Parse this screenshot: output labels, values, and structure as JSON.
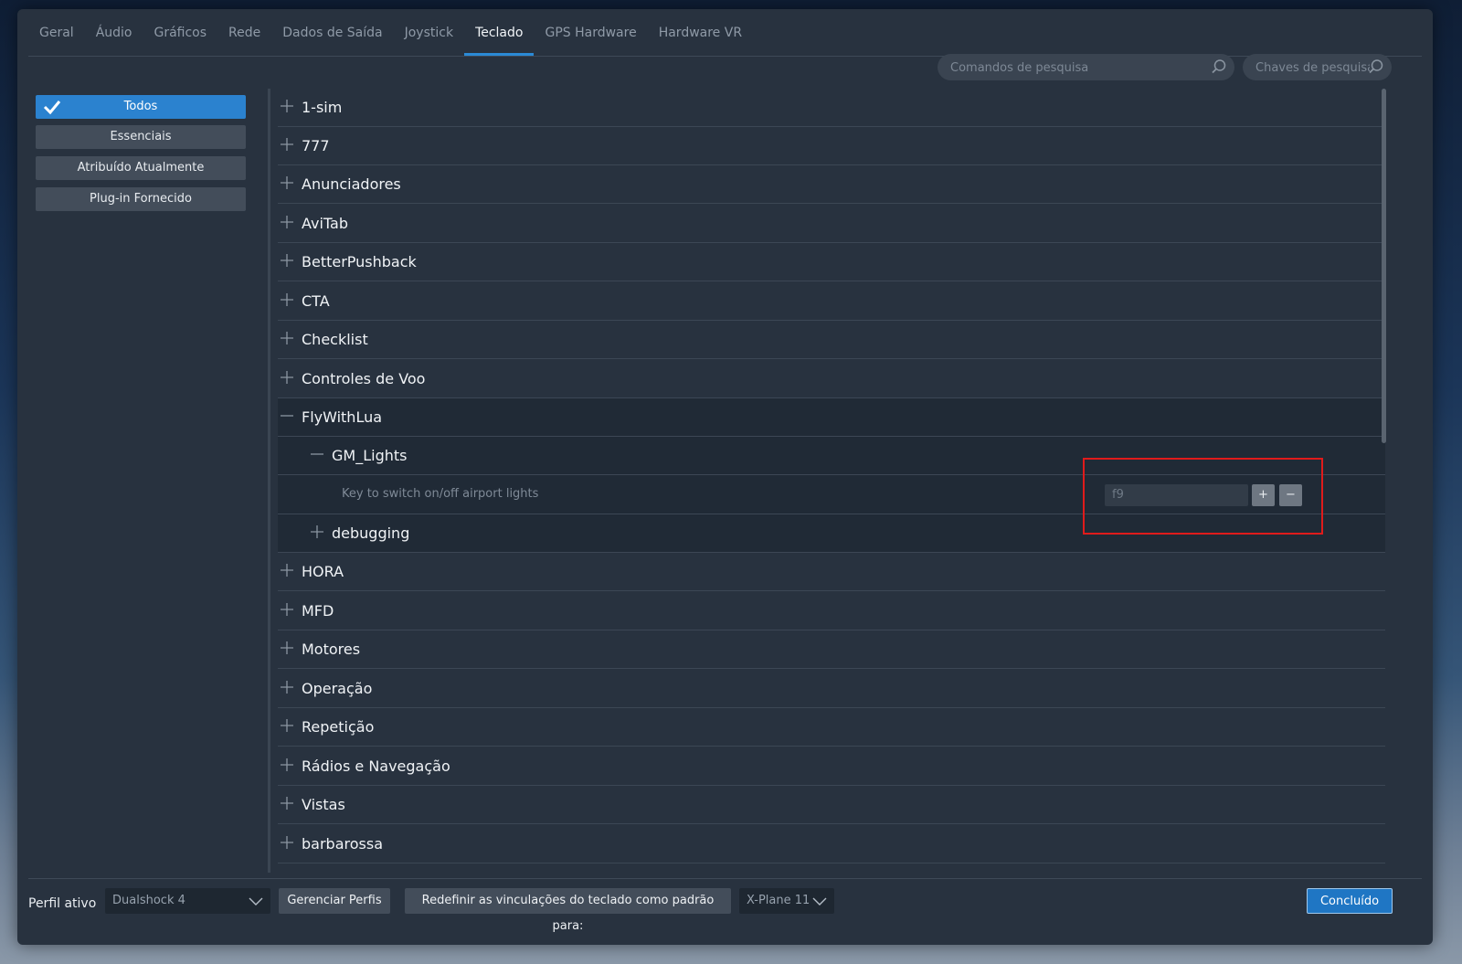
{
  "tabs": [
    "Geral",
    "Áudio",
    "Gráficos",
    "Rede",
    "Dados de Saída",
    "Joystick",
    "Teclado",
    "GPS Hardware",
    "Hardware VR"
  ],
  "active_tab": "Teclado",
  "search": {
    "commands_placeholder": "Comandos de pesquisa",
    "keys_placeholder": "Chaves de pesquisa"
  },
  "filters": {
    "all": "Todos",
    "essentials": "Essenciais",
    "assigned": "Atribuído Atualmente",
    "plugin": "Plug-in Fornecido"
  },
  "categories": {
    "c1sim": "1-sim",
    "c777": "777",
    "anunciadores": "Anunciadores",
    "avitab": "AviTab",
    "betterpushback": "BetterPushback",
    "cta": "CTA",
    "checklist": "Checklist",
    "controles": "Controles de Voo",
    "flywithlua": "FlyWithLua",
    "hora": "HORA",
    "mfd": "MFD",
    "motores": "Motores",
    "operacao": "Operação",
    "repeticao": "Repetição",
    "radios": "Rádios e Navegação",
    "vistas": "Vistas",
    "barbarossa": "barbarossa"
  },
  "flywithlua": {
    "group": "GM_Lights",
    "command": "Key to switch on/off airport lights",
    "key": "f9",
    "add": "+",
    "remove": "−",
    "subgroup": "debugging"
  },
  "footer": {
    "profile_label": "Perfil ativo",
    "profile_value": "Dualshock 4",
    "manage": "Gerenciar Perfis",
    "reset": "Redefinir as vinculações do teclado como padrão para:",
    "reset_target": "X-Plane 11",
    "done": "Concluído"
  },
  "colors": {
    "accent": "#2b82cf",
    "panel": "#28323f",
    "highlight": "#e01b1b"
  }
}
